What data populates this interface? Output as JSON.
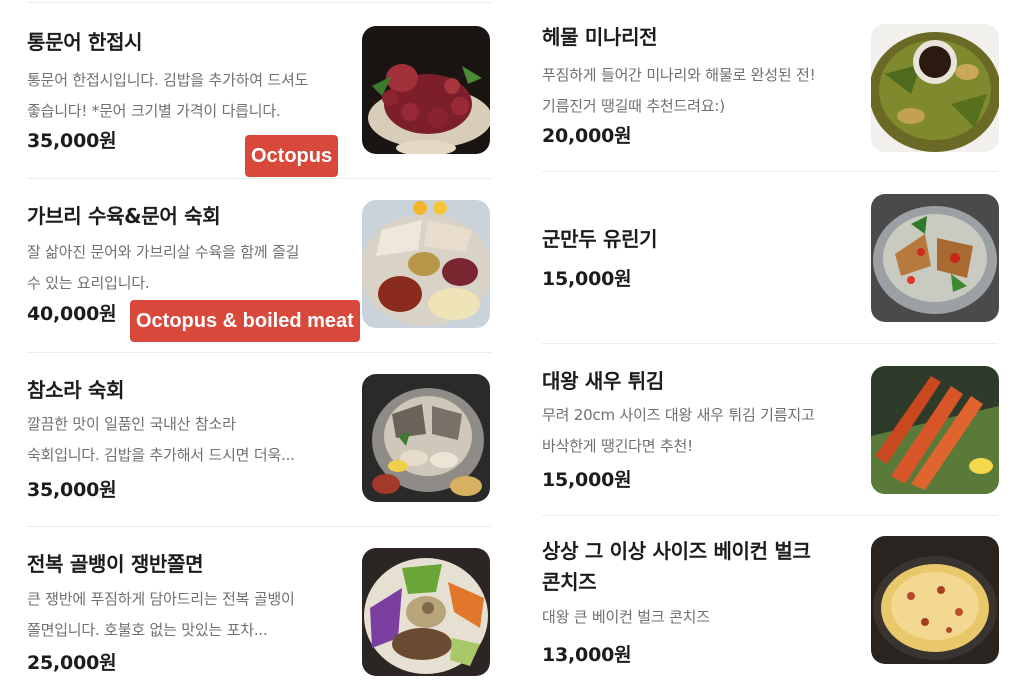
{
  "left_items": [
    {
      "title": "통문어 한접시",
      "desc_line1": "통문어 한접시입니다. 김밥을 추가하여 드셔도",
      "desc_line2": "좋습니다! *문어 크기별 가격이 다릅니다.",
      "price": "35,000원",
      "image_icon": "octopus-plate-photo",
      "overlay_label": "Octopus"
    },
    {
      "title": "가브리 수육&문어 숙회",
      "desc_line1": "잘 삶아진 문어와 가브리살 수육을 함께 즐길",
      "desc_line2": "수 있는 요리입니다.",
      "price": "40,000원",
      "image_icon": "boiled-meat-octopus-photo",
      "overlay_label": "Octopus & boiled meat"
    },
    {
      "title": "참소라 숙회",
      "desc_line1": "깔끔한 맛이 일품인 국내산 참소라",
      "desc_line2": "숙회입니다. 김밥을 추가해서 드시면 더욱...",
      "price": "35,000원",
      "image_icon": "conch-platter-photo"
    },
    {
      "title": "전복 골뱅이 쟁반쫄면",
      "desc_line1": "큰 쟁반에 푸짐하게 담아드리는 전복 골뱅이",
      "desc_line2": "쫄면입니다. 호불호 없는 맛있는 포차...",
      "price": "25,000원",
      "image_icon": "noodle-salad-photo"
    }
  ],
  "right_items": [
    {
      "title": "헤물 미나리전",
      "desc_line1": "푸짐하게 들어간 미나리와 해물로 완성된 전!",
      "desc_line2": "기름진거 땡길때 추천드려요:)",
      "price": "20,000원",
      "image_icon": "seafood-pancake-photo"
    },
    {
      "title": "군만두 유린기",
      "price": "15,000원",
      "image_icon": "fried-dumpling-photo"
    },
    {
      "title": "대왕 새우 튀김",
      "desc_line1": "무려 20cm 사이즈 대왕 새우 튀김 기름지고",
      "desc_line2": "바삭한게 땡긴다면 추천!",
      "price": "15,000원",
      "image_icon": "fried-shrimp-photo"
    },
    {
      "title_line1": "상상 그 이상 사이즈 베이컨 벌크",
      "title_line2": "콘치즈",
      "desc_line1": "대왕 큰 베이컨 벌크 콘치즈",
      "price": "13,000원",
      "image_icon": "corn-cheese-photo"
    }
  ],
  "colors": {
    "label_red": "#d9493b",
    "divider": "#ececec",
    "desc_gray": "#707070"
  }
}
